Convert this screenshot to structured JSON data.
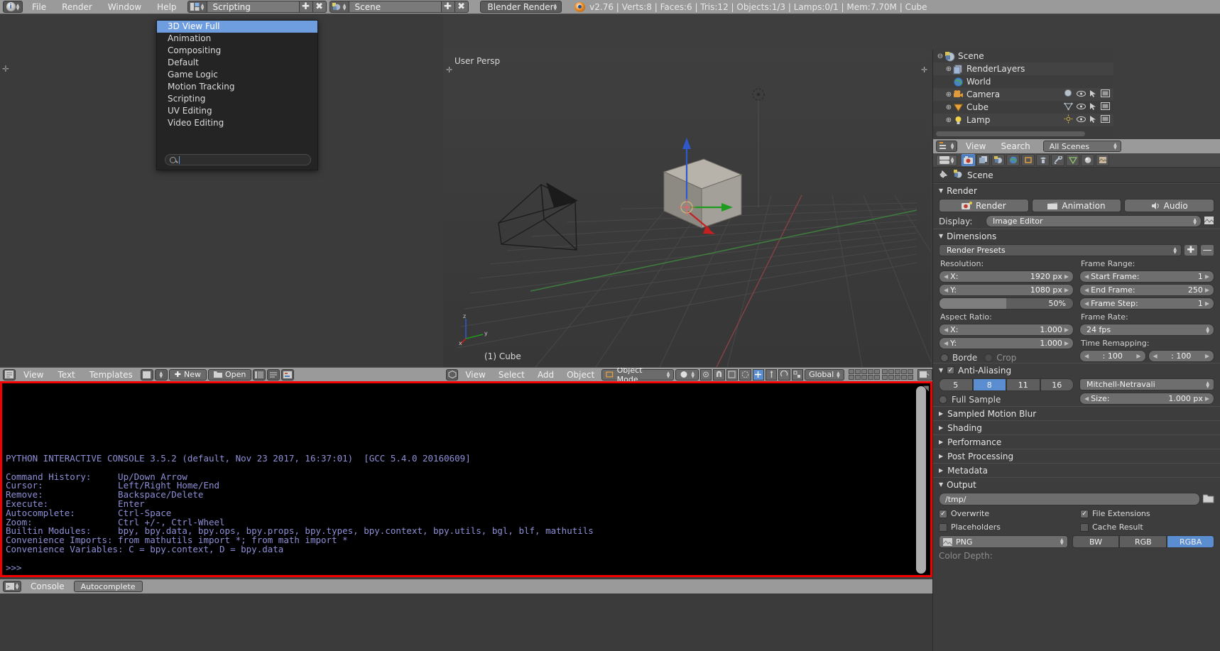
{
  "topbar": {
    "menus": [
      "File",
      "Render",
      "Window",
      "Help"
    ],
    "screen_layout": "Scripting",
    "scene_name": "Scene",
    "engine": "Blender Render",
    "stats": "v2.76 | Verts:8 | Faces:6 | Tris:12 | Objects:1/3 | Lamps:0/1 | Mem:7.70M | Cube",
    "add_icon": "plus-icon",
    "delete_icon": "x-icon"
  },
  "layout_dropdown": {
    "items": [
      {
        "label": "3D View Full",
        "selected": true
      },
      {
        "label": "Animation",
        "selected": false
      },
      {
        "label": "Compositing",
        "selected": false
      },
      {
        "label": "Default",
        "selected": false
      },
      {
        "label": "Game Logic",
        "selected": false
      },
      {
        "label": "Motion Tracking",
        "selected": false
      },
      {
        "label": "Scripting",
        "selected": false
      },
      {
        "label": "UV Editing",
        "selected": false
      },
      {
        "label": "Video Editing",
        "selected": false
      }
    ],
    "search_value": "",
    "search_icon": "search-icon"
  },
  "viewport": {
    "perspective_label": "User Persp",
    "object_label": "(1) Cube",
    "axis_x": "x",
    "axis_y": "y",
    "axis_z": "z"
  },
  "viewport_header": {
    "menus": [
      "View",
      "Select",
      "Add",
      "Object"
    ],
    "mode": "Object Mode",
    "transform_orientation": "Global",
    "editor_icon": "3d-view-icon"
  },
  "text_editor_header": {
    "menus": [
      "View",
      "Text",
      "Templates"
    ],
    "new_button": "New",
    "open_button": "Open",
    "editor_icon": "text-editor-icon"
  },
  "outliner": {
    "display_mode": "All Scenes",
    "menus": [
      "View",
      "Search"
    ],
    "rows": [
      {
        "label": "Scene",
        "icon": "scene-icon",
        "expander": "minus",
        "indent": 0
      },
      {
        "label": "RenderLayers",
        "icon": "renderlayers-icon",
        "expander": "plus",
        "indent": 1
      },
      {
        "label": "World",
        "icon": "world-icon",
        "expander": "none",
        "indent": 1
      },
      {
        "label": "Camera",
        "icon": "camera-icon",
        "expander": "plus",
        "indent": 1
      },
      {
        "label": "Cube",
        "icon": "mesh-icon",
        "expander": "plus",
        "indent": 1
      },
      {
        "label": "Lamp",
        "icon": "lamp-icon",
        "expander": "plus",
        "indent": 1
      }
    ]
  },
  "properties": {
    "breadcrumb_scene": "Scene",
    "pin_icon": "pin-icon",
    "tabs": [
      {
        "name": "render-tab",
        "icon": "camera-back-icon",
        "active": true
      },
      {
        "name": "render-layers-tab",
        "icon": "layers-icon",
        "active": false
      },
      {
        "name": "scene-tab",
        "icon": "scene-icon",
        "active": false
      },
      {
        "name": "world-tab",
        "icon": "world-icon",
        "active": false
      },
      {
        "name": "object-tab",
        "icon": "object-icon",
        "active": false
      },
      {
        "name": "constraints-tab",
        "icon": "constraint-icon",
        "active": false
      },
      {
        "name": "modifiers-tab",
        "icon": "wrench-icon",
        "active": false
      },
      {
        "name": "data-tab",
        "icon": "data-icon",
        "active": false
      },
      {
        "name": "material-tab",
        "icon": "material-icon",
        "active": false
      },
      {
        "name": "texture-tab",
        "icon": "texture-icon",
        "active": false
      }
    ],
    "render": {
      "title": "Render",
      "render_button": "Render",
      "animation_button": "Animation",
      "audio_button": "Audio",
      "display_label": "Display:",
      "display_value": "Image Editor"
    },
    "dimensions": {
      "title": "Dimensions",
      "presets_label": "Render Presets",
      "resolution_label": "Resolution:",
      "res_x_label": "X:",
      "res_x_value": "1920 px",
      "res_y_label": "Y:",
      "res_y_value": "1080 px",
      "res_percent": "50%",
      "frame_range_label": "Frame Range:",
      "start_frame_label": "Start Frame:",
      "start_frame_value": "1",
      "end_frame_label": "End Frame:",
      "end_frame_value": "250",
      "frame_step_label": "Frame Step:",
      "frame_step_value": "1",
      "aspect_label": "Aspect Ratio:",
      "aspect_x_label": "X:",
      "aspect_x_value": "1.000",
      "aspect_y_label": "Y:",
      "aspect_y_value": "1.000",
      "frame_rate_label": "Frame Rate:",
      "frame_rate_value": "24 fps",
      "time_remap_label": "Time Remapping:",
      "old_value": ": 100",
      "new_value": ": 100",
      "border_label": "Borde",
      "crop_label": "Crop"
    },
    "antialiasing": {
      "title": "Anti-Aliasing",
      "samples": [
        "5",
        "8",
        "11",
        "16"
      ],
      "active_sample": "8",
      "filter": "Mitchell-Netravali",
      "full_sample_label": "Full Sample",
      "size_label": "Size:",
      "size_value": "1.000 px"
    },
    "collapsed_panels": [
      "Sampled Motion Blur",
      "Shading",
      "Performance",
      "Post Processing",
      "Metadata"
    ],
    "output": {
      "title": "Output",
      "path": "/tmp/",
      "overwrite": "Overwrite",
      "file_extensions": "File Extensions",
      "placeholders": "Placeholders",
      "cache_result": "Cache Result",
      "format": "PNG",
      "color_modes": [
        "BW",
        "RGB",
        "RGBA"
      ],
      "active_color_mode": "RGBA",
      "color_depth_label": "Color Depth:"
    }
  },
  "console": {
    "lines": [
      "PYTHON INTERACTIVE CONSOLE 3.5.2 (default, Nov 23 2017, 16:37:01)  [GCC 5.4.0 20160609]",
      "",
      "Command History:     Up/Down Arrow",
      "Cursor:              Left/Right Home/End",
      "Remove:              Backspace/Delete",
      "Execute:             Enter",
      "Autocomplete:        Ctrl-Space",
      "Zoom:                Ctrl +/-, Ctrl-Wheel",
      "Builtin Modules:     bpy, bpy.data, bpy.ops, bpy.props, bpy.types, bpy.context, bpy.utils, bgl, blf, mathutils",
      "Convenience Imports: from mathutils import *; from math import *",
      "Convenience Variables: C = bpy.context, D = bpy.data",
      "",
      ">>> "
    ],
    "prompt": ">>> ",
    "text_color": "#8f8fd8",
    "highlight_border_color": "#f20000"
  },
  "console_footer": {
    "menus": [
      "Console"
    ],
    "autocomplete_button": "Autocomplete",
    "editor_icon": "console-icon"
  }
}
